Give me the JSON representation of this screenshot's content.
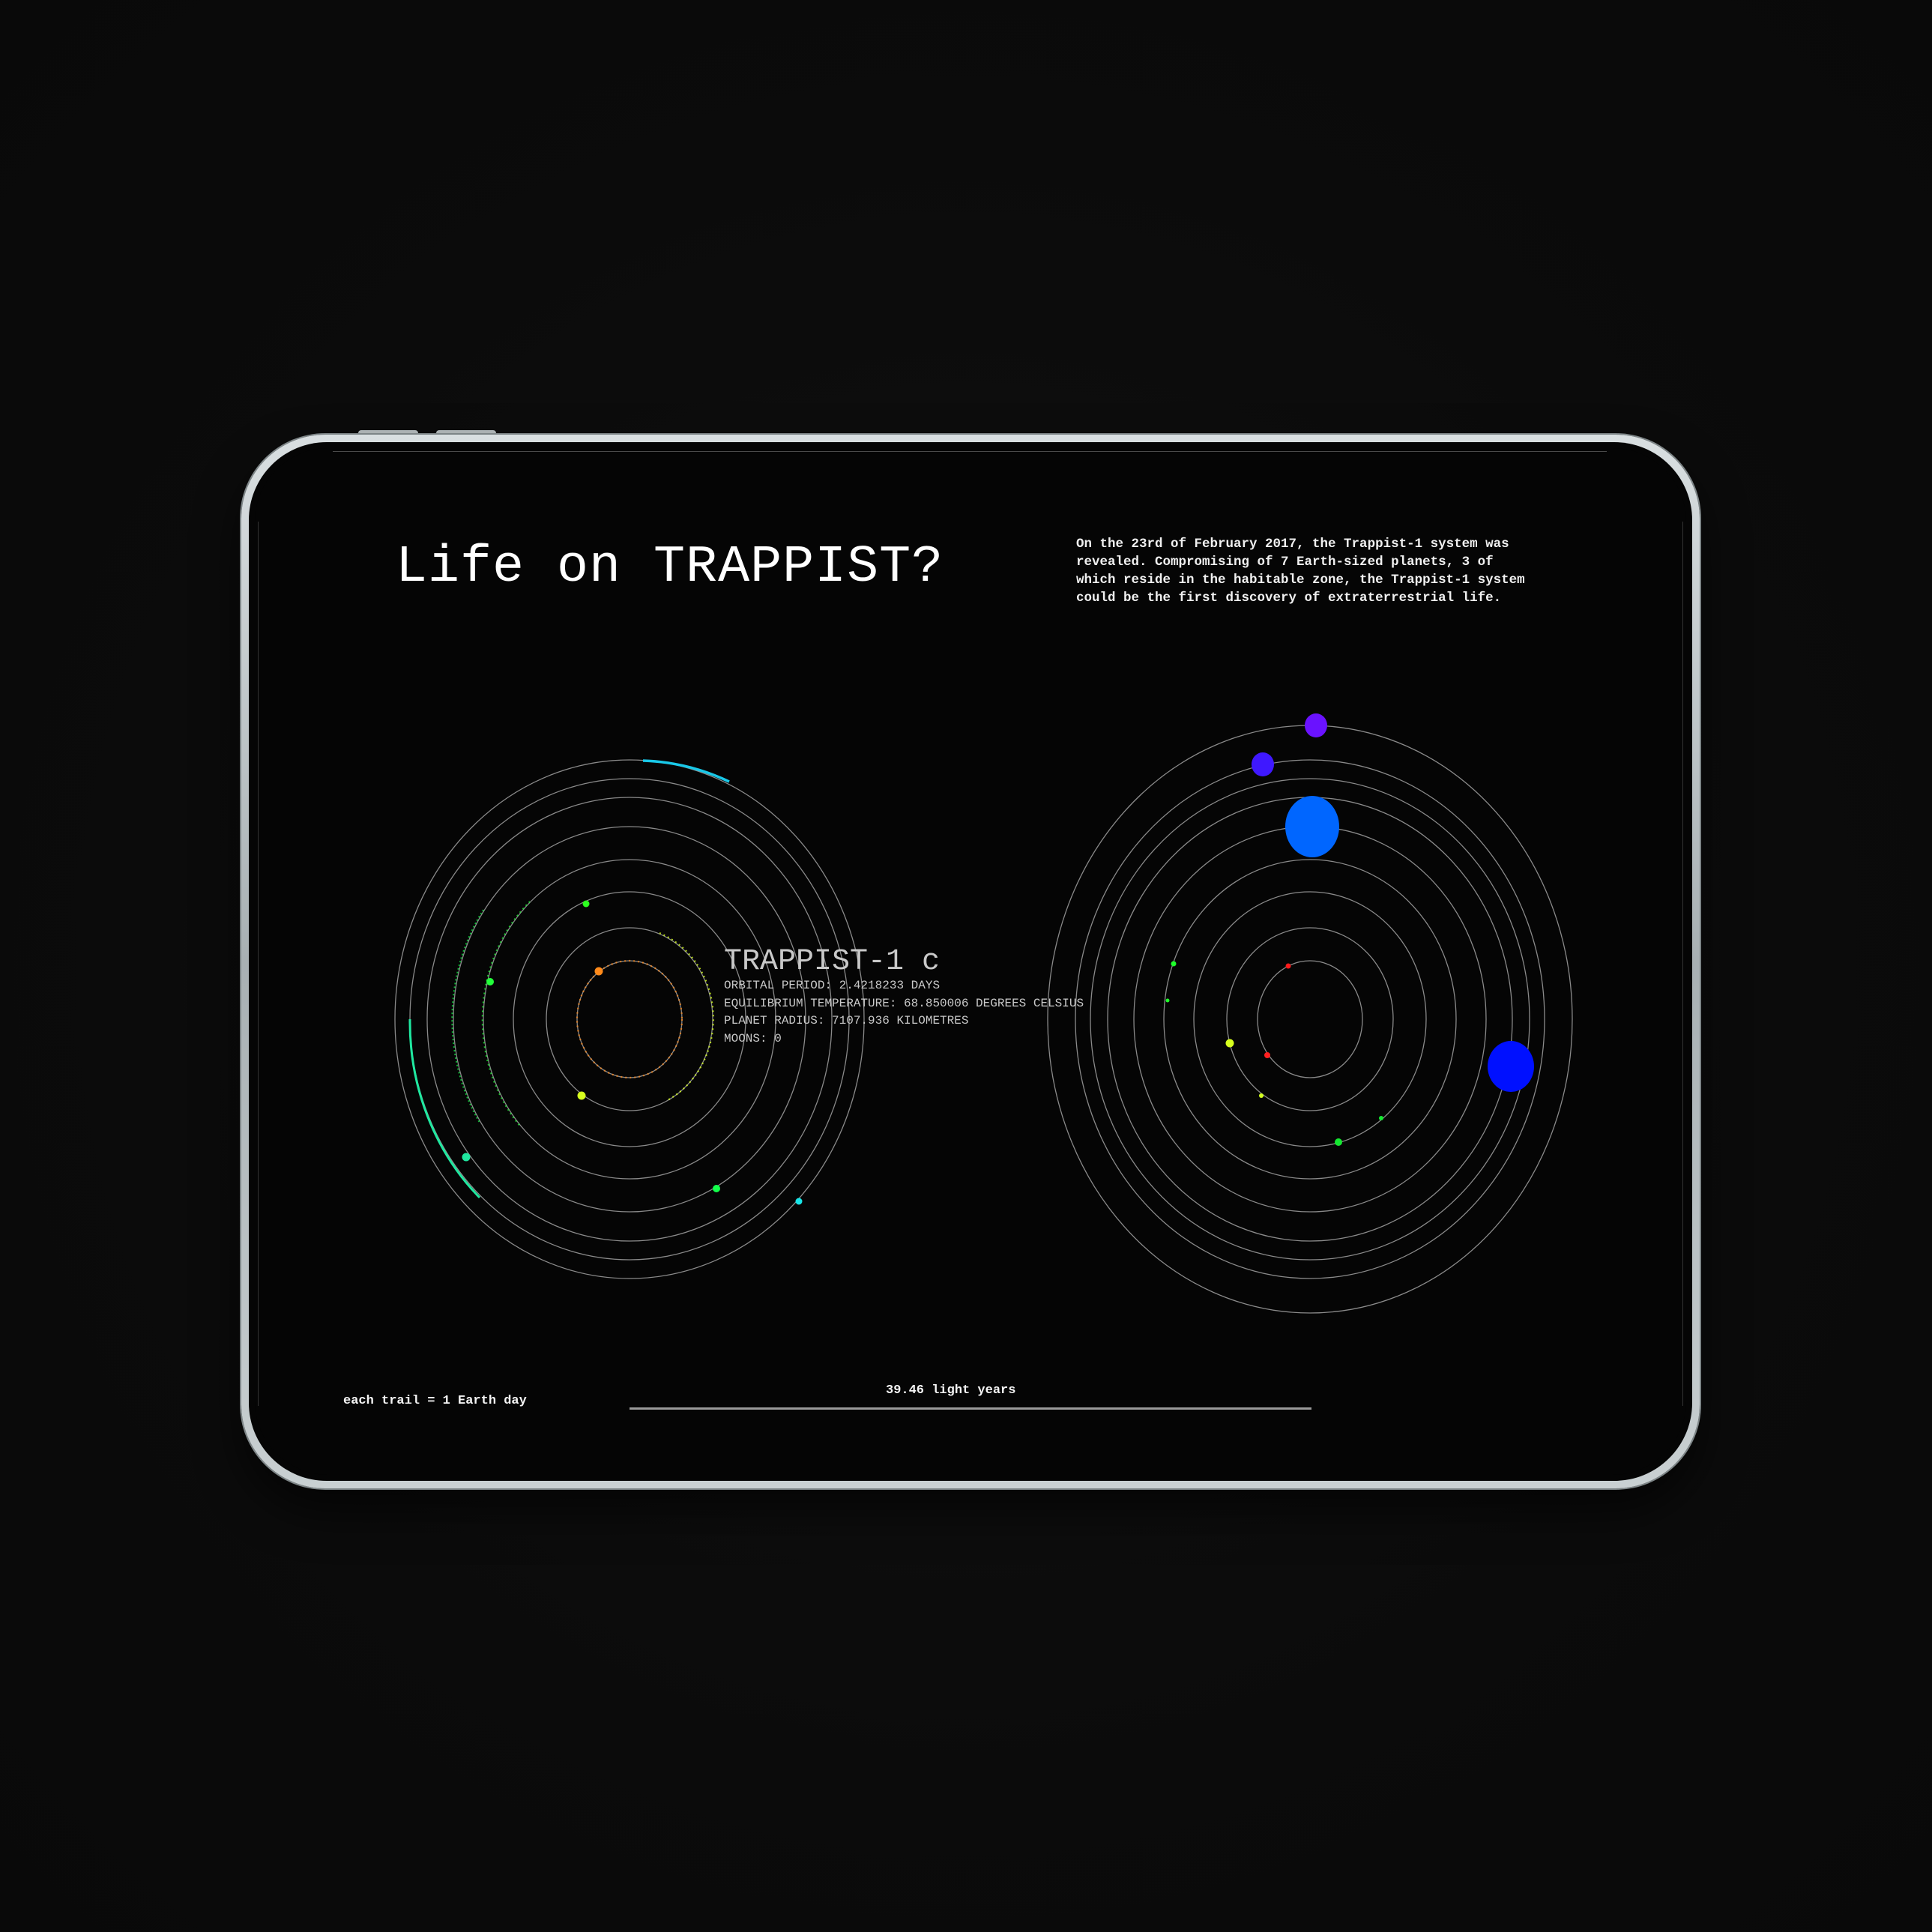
{
  "header": {
    "title": "Life on TRAPPIST?",
    "intro_lines": [
      "On the 23rd of February 2017, the Trappist-1 system was",
      "revealed. Compromising of 7 Earth-sized planets, 3 of",
      "which reside in the habitable zone, the Trappist-1 system",
      "could be the first discovery of extraterrestrial life."
    ]
  },
  "selected_planet": {
    "name": "TRAPPIST-1 c",
    "orbital_period": "ORBITAL PERIOD: 2.4218233 DAYS",
    "temperature": "EQUILIBRIUM TEMPERATURE: 68.850006 DEGREES CELSIUS",
    "radius": "PLANET RADIUS: 7107.936 KILOMETRES",
    "moons": "MOONS: 0"
  },
  "footer": {
    "trail_note": "each trail = 1 Earth day",
    "distance_label": "39.46 light years"
  },
  "colors": {
    "background": "#050505",
    "orbit": "#8a8a8a",
    "text": "#ffffff",
    "info_text": "#c9c9c9"
  },
  "left_system": {
    "orbit_count": 8,
    "planets": [
      {
        "orbit": 1,
        "color": "#ff8a1a"
      },
      {
        "orbit": 2,
        "color": "#d7ff1e"
      },
      {
        "orbit": 3,
        "color": "#2cff1e"
      },
      {
        "orbit": 4,
        "color": "#22ff3a"
      },
      {
        "orbit": 5,
        "color": "#12ff4a"
      },
      {
        "orbit": 6,
        "color": "#1fe8a0"
      },
      {
        "orbit": 7,
        "color": "#19e5e8"
      }
    ]
  },
  "right_system": {
    "orbit_count": 9,
    "planets": [
      {
        "orbit": 1,
        "color": "#ff1a1a"
      },
      {
        "orbit": 2,
        "color": "#ff2020"
      },
      {
        "orbit": 3,
        "color": "#d7ff1e"
      },
      {
        "orbit": 4,
        "color": "#d2ff1e"
      },
      {
        "orbit": 5,
        "color": "#1eff2a"
      },
      {
        "orbit": 6,
        "color": "#14e830"
      },
      {
        "orbit": 7,
        "color": "#0066ff"
      },
      {
        "orbit": 8,
        "color": "#0010ff"
      },
      {
        "orbit": 9,
        "color": "#3f18ff"
      },
      {
        "orbit": 10,
        "color": "#6a12ff"
      }
    ]
  }
}
